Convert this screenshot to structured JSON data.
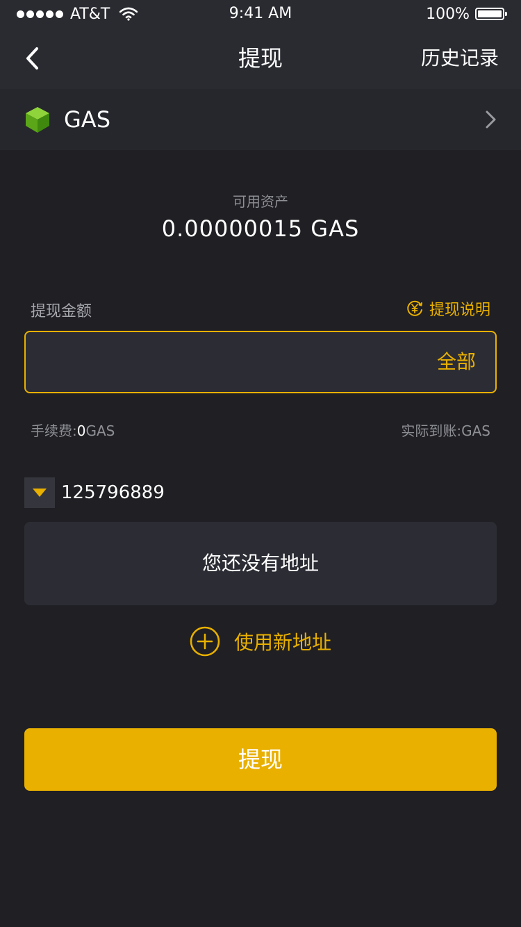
{
  "status_bar": {
    "carrier": "AT&T",
    "time": "9:41 AM",
    "battery": "100%"
  },
  "nav": {
    "title": "提现",
    "history": "历史记录"
  },
  "coin": {
    "name": "GAS",
    "icon": "cube-icon",
    "icon_color": "#6dbb1e"
  },
  "balance": {
    "label": "可用资产",
    "value": "0.00000015  GAS"
  },
  "amount": {
    "label": "提现金额",
    "explain": "提现说明",
    "value": "",
    "placeholder": "",
    "all_label": "全部"
  },
  "fee": {
    "label": "手续费:",
    "value": "0",
    "unit": "GAS"
  },
  "arrival": {
    "label": "实际到账:",
    "unit": "GAS"
  },
  "account": {
    "id": "125796889"
  },
  "address": {
    "empty": "您还没有地址",
    "new_label": "使用新地址"
  },
  "submit": {
    "label": "提现"
  },
  "colors": {
    "accent": "#e9b000",
    "background": "#1f1f24",
    "card": "#2c2d34",
    "muted_text": "#8e8f95"
  }
}
